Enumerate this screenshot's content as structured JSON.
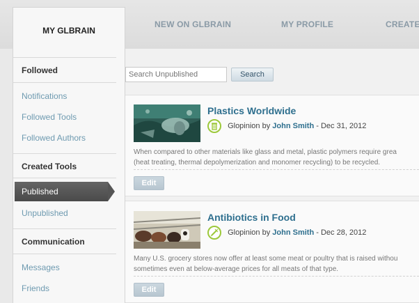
{
  "tabs": {
    "active": "MY GLBRAIN",
    "items": [
      "NEW ON GLBRAIN",
      "MY PROFILE",
      "CREATE C"
    ]
  },
  "sidebar": {
    "followed_heading": "Followed",
    "followed_items": [
      "Notifications",
      "Followed Tools",
      "Followed Authors"
    ],
    "created_heading": "Created Tools",
    "created_items": [
      "Published",
      "Unpublished"
    ],
    "communication_heading": "Communication",
    "communication_items": [
      "Messages",
      "Friends"
    ]
  },
  "search": {
    "placeholder": "Search Unpublished",
    "button": "Search"
  },
  "cards": [
    {
      "title": "Plastics Worldwide",
      "type": "Glopinion",
      "by": "by",
      "author": "John Smith",
      "date": "- Dec 31, 2012",
      "desc_line1": "When compared to other materials like glass and metal, plastic polymers require grea",
      "desc_line2": "(heat treating, thermal depolymerization and monomer recycling) to be recycled.",
      "edit": "Edit",
      "icon": "trash-can-icon"
    },
    {
      "title": "Antibiotics in Food",
      "type": "Glopinion",
      "by": "by",
      "author": "John Smith",
      "date": "- Dec 28, 2012",
      "desc_line1": "Many U.S. grocery stores now offer at least some meat or poultry that is raised withou",
      "desc_line2": "sometimes even at below-average prices for all meats of that type.",
      "edit": "Edit",
      "icon": "syringe-icon"
    }
  ],
  "colors": {
    "link": "#2e6f8e",
    "sidebar_link": "#6e9ab0",
    "icon_green": "#9cc83a"
  }
}
